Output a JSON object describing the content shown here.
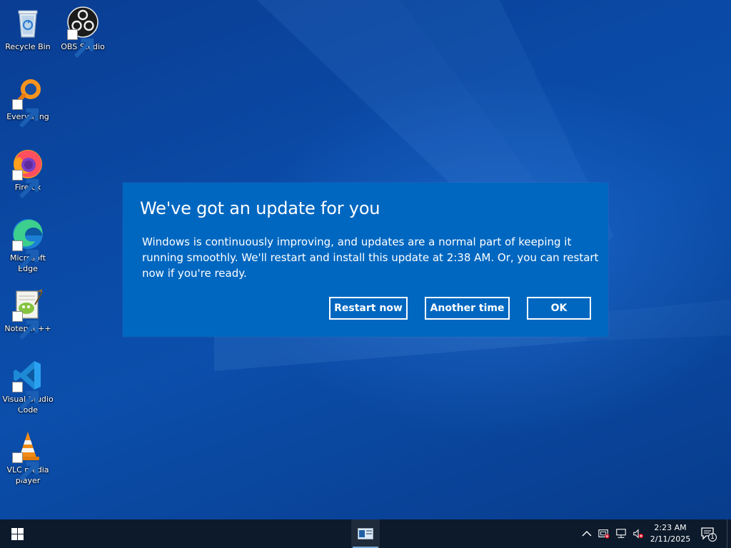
{
  "desktop": {
    "icons": [
      {
        "label": "Recycle Bin",
        "icon": "recycle-bin-icon"
      },
      {
        "label": "OBS Studio",
        "icon": "obs-studio-icon"
      },
      {
        "label": "Everything",
        "icon": "everything-search-icon"
      },
      {
        "label": "Firefox",
        "icon": "firefox-icon"
      },
      {
        "label": "Microsoft Edge",
        "icon": "edge-icon"
      },
      {
        "label": "Notepad++",
        "icon": "notepad-plus-plus-icon"
      },
      {
        "label": "Visual Studio Code",
        "icon": "vscode-icon"
      },
      {
        "label": "VLC media player",
        "icon": "vlc-icon"
      }
    ]
  },
  "dialog": {
    "title": "We've got an update for you",
    "body": "Windows is continuously improving, and updates are a normal part of keeping it running smoothly. We'll restart and install this update at 2:38 AM. Or, you can restart now if you're ready.",
    "buttons": {
      "restart_now": "Restart now",
      "another_time": "Another time",
      "ok": "OK"
    }
  },
  "taskbar": {
    "time": "2:23 AM",
    "date": "2/11/2025",
    "notification_count": "1",
    "tray_icons": [
      "chevron-up-icon",
      "security-alert-icon",
      "network-icon",
      "volume-muted-icon"
    ]
  },
  "colors": {
    "dialog_background": "#0067c0",
    "taskbar_background": "#0c1a2b",
    "desktop_background": "#0a4aa6"
  }
}
